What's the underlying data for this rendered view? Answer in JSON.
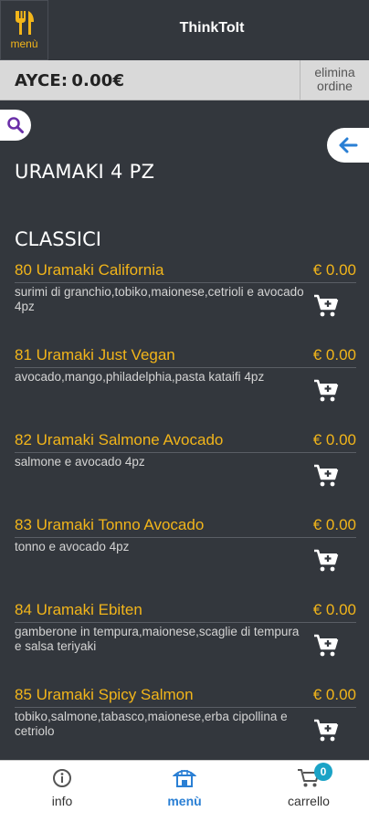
{
  "header": {
    "menu_label": "menù",
    "app_title": "ThinkToIt"
  },
  "order_bar": {
    "ayce_label": "AYCE:",
    "ayce_total": "0.00€",
    "delete_label_line1": "elimina",
    "delete_label_line2": "ordine"
  },
  "category": {
    "title": "URAMAKI 4 PZ",
    "section": "CLASSICI"
  },
  "items": [
    {
      "name": "80 Uramaki California",
      "price": "€ 0.00",
      "description": "surimi di granchio,tobiko,maionese,cetrioli e avocado 4pz"
    },
    {
      "name": "81 Uramaki Just Vegan",
      "price": "€ 0.00",
      "description": "avocado,mango,philadelphia,pasta kataifi 4pz"
    },
    {
      "name": "82 Uramaki Salmone Avocado",
      "price": "€ 0.00",
      "description": "salmone e avocado 4pz"
    },
    {
      "name": "83 Uramaki Tonno Avocado",
      "price": "€ 0.00",
      "description": "tonno e avocado 4pz"
    },
    {
      "name": "84 Uramaki Ebiten",
      "price": "€ 0.00",
      "description": "gamberone in tempura,maionese,scaglie di tempura e salsa teriyaki"
    },
    {
      "name": "85 Uramaki Spicy Salmon",
      "price": "€ 0.00",
      "description": "tobiko,salmone,tabasco,maionese,erba cipollina e cetriolo"
    }
  ],
  "bottom_nav": {
    "info_label": "info",
    "menu_label": "menù",
    "cart_label": "carrello",
    "cart_count": "0"
  },
  "colors": {
    "background": "#33373d",
    "accent": "#f2b51a",
    "active_nav": "#2a7fd4",
    "badge": "#1ba3c6"
  }
}
